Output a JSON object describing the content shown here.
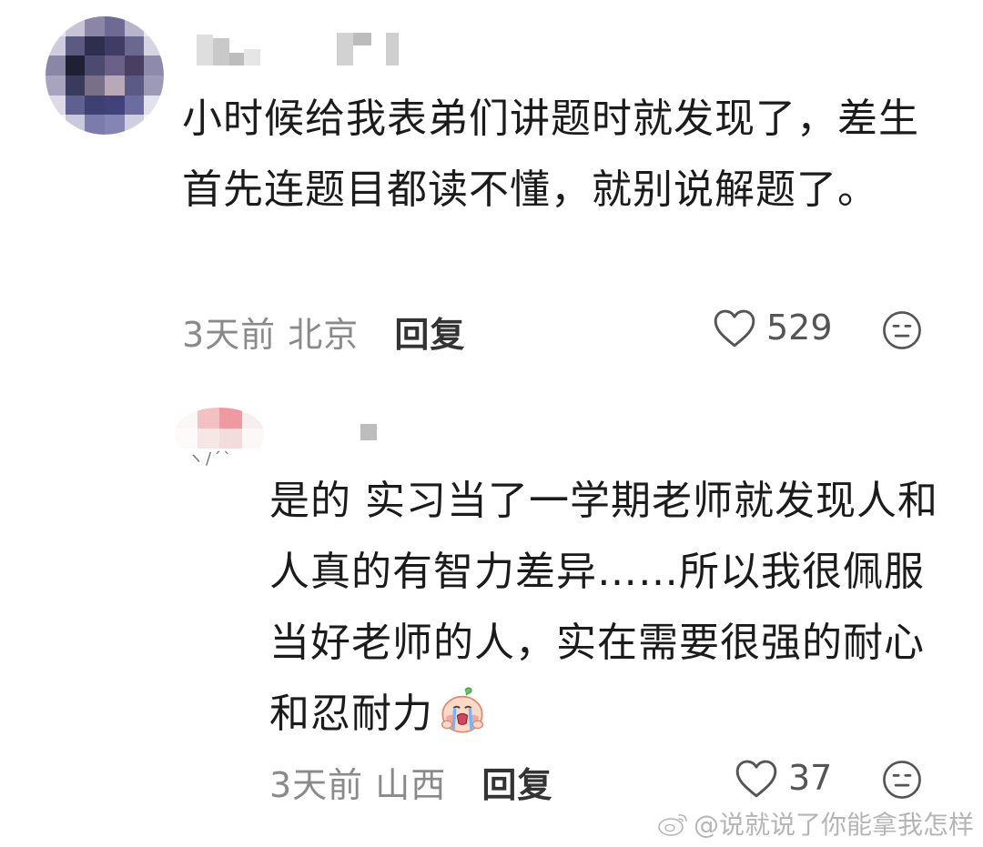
{
  "comment": {
    "text": "小时候给我表弟们讲题时就发现了，差生首先连题目都读不懂，就别说解题了。",
    "time": "3天前",
    "location": "北京",
    "reply_label": "回复",
    "likes": "529"
  },
  "reply": {
    "text": "是的 实习当了一学期老师就发现人和人真的有智力差异……所以我很佩服当好老师的人，实在需要很强的耐心和忍耐力",
    "time": "3天前",
    "location": "山西",
    "reply_label": "回复",
    "likes": "37"
  },
  "watermark": {
    "text": "@说就说了你能拿我怎样"
  },
  "icons": {
    "like": "heart-outline-icon",
    "dislike": "unhappy-face-icon",
    "emoji": "crying-face-emoji",
    "weibo": "weibo-logo-icon"
  }
}
